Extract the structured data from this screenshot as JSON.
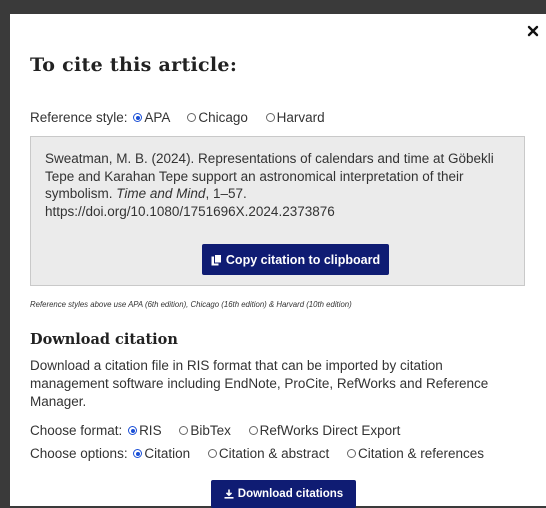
{
  "dialog": {
    "title": "To cite this article:",
    "close_icon": "close-icon"
  },
  "reference_style": {
    "label": "Reference style:",
    "options": [
      "APA",
      "Chicago",
      "Harvard"
    ],
    "selected": "APA"
  },
  "citation": {
    "text_before": "Sweatman, M. B. (2024). Representations of calendars and time at Göbekli Tepe and Karahan Tepe support an astronomical interpretation of their symbolism. ",
    "journal": "Time and Mind",
    "text_after": ", 1–57.",
    "doi": "https://doi.org/10.1080/1751696X.2024.2373876",
    "copy_button_label": "Copy citation to clipboard",
    "copy_icon": "clipboard-icon"
  },
  "note": "Reference styles above use APA (6th edition), Chicago (16th edition) & Harvard (10th edition)",
  "download": {
    "heading": "Download citation",
    "description": "Download a citation file in RIS format that can be imported by citation management software including EndNote, ProCite, RefWorks and Reference Manager.",
    "format_label": "Choose format:",
    "formats": [
      "RIS",
      "BibTex",
      "RefWorks Direct Export"
    ],
    "selected_format": "RIS",
    "options_label": "Choose options:",
    "options": [
      "Citation",
      "Citation & abstract",
      "Citation & references"
    ],
    "selected_option": "Citation",
    "button_label": "Download citations",
    "download_icon": "download-icon"
  },
  "colors": {
    "button_bg": "#0f1c73",
    "radio_selected": "#1a4fd6",
    "citation_box_bg": "#ebebeb"
  }
}
